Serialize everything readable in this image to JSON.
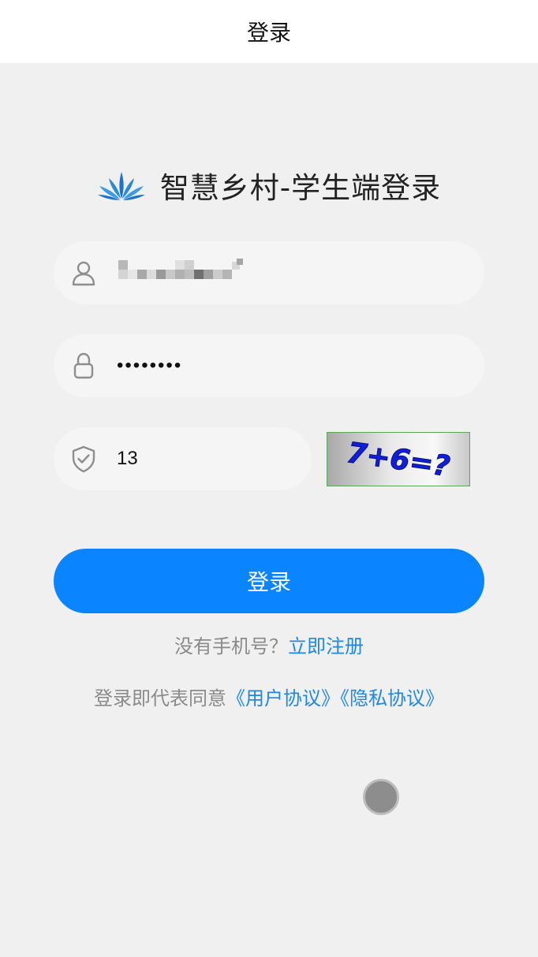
{
  "header": {
    "title": "登录"
  },
  "brand": {
    "title": "智慧乡村-学生端登录",
    "logo_icon": "lotus-logo-icon",
    "logo_color": "#1e73c8"
  },
  "form": {
    "username": {
      "icon": "user-icon",
      "value": ""
    },
    "password": {
      "icon": "lock-icon",
      "value": "••••••••"
    },
    "captcha": {
      "icon": "shield-check-icon",
      "value": "13",
      "image_text": "7+6=?"
    },
    "login_button_label": "登录"
  },
  "register": {
    "prompt": "没有手机号？",
    "link": "立即注册"
  },
  "agreement": {
    "prefix": "登录即代表同意",
    "user_agreement": "《用户协议》",
    "privacy_agreement": "《隐私协议》"
  },
  "colors": {
    "primary": "#0a84ff",
    "link": "#1e88e5",
    "background": "#f0f0f0",
    "field_background": "#f5f5f5"
  }
}
